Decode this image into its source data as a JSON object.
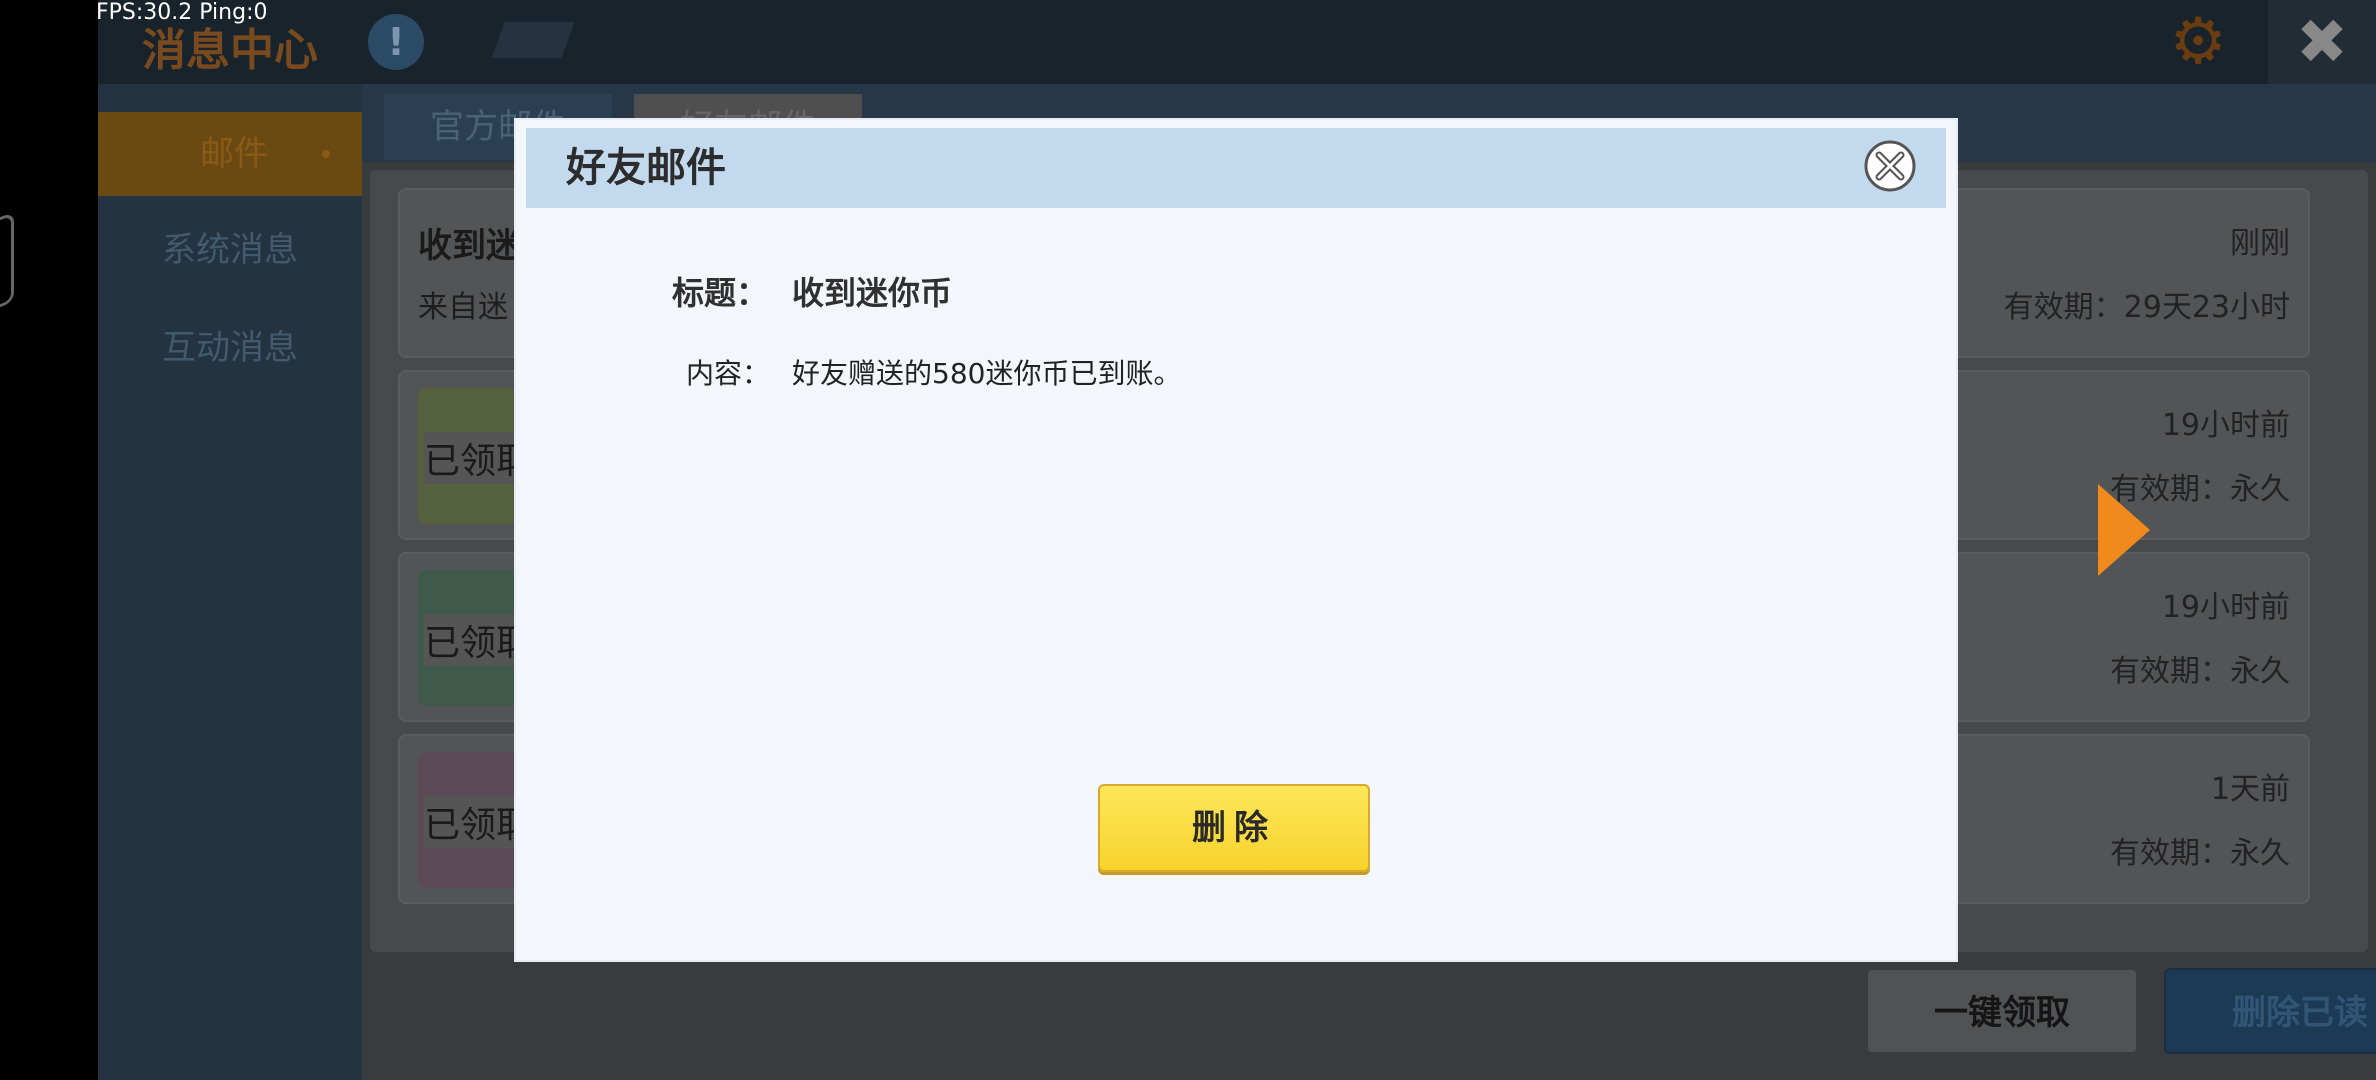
{
  "overlay": {
    "fps_text": "FPS:30.2  Ping:0"
  },
  "header": {
    "title": "消息中心",
    "info_icon": "!",
    "gear_icon": "gear-icon",
    "close_icon": "✖"
  },
  "sidebar": {
    "items": [
      {
        "label": "邮件",
        "active": true
      },
      {
        "label": "系统消息",
        "active": false
      },
      {
        "label": "互动消息",
        "active": false
      }
    ]
  },
  "tabs": [
    {
      "label": "官方邮件"
    },
    {
      "label": "好友邮件"
    }
  ],
  "mail_list": [
    {
      "title": "收到迷",
      "from": "来自迷",
      "time": "刚刚",
      "expire": "有效期：29天23小时"
    },
    {
      "stamp": "已领取",
      "time": "19小时前",
      "expire": "有效期：永久"
    },
    {
      "stamp": "已领取",
      "time": "19小时前",
      "expire": "有效期：永久"
    },
    {
      "stamp": "已领取",
      "time": "1天前",
      "expire": "有效期：永久"
    }
  ],
  "bottom_buttons": {
    "claim_all": "一键领取",
    "delete_read": "删除已读"
  },
  "modal": {
    "title": "好友邮件",
    "subject_label": "标题：",
    "subject_value": "收到迷你币",
    "content_label": "内容：",
    "content_value": "好友赠送的580迷你币已到账。",
    "delete_label": "删除"
  },
  "colors": {
    "accent_orange": "#f08a1c",
    "button_yellow": "#fde75a",
    "modal_header": "#c3d9ee"
  }
}
